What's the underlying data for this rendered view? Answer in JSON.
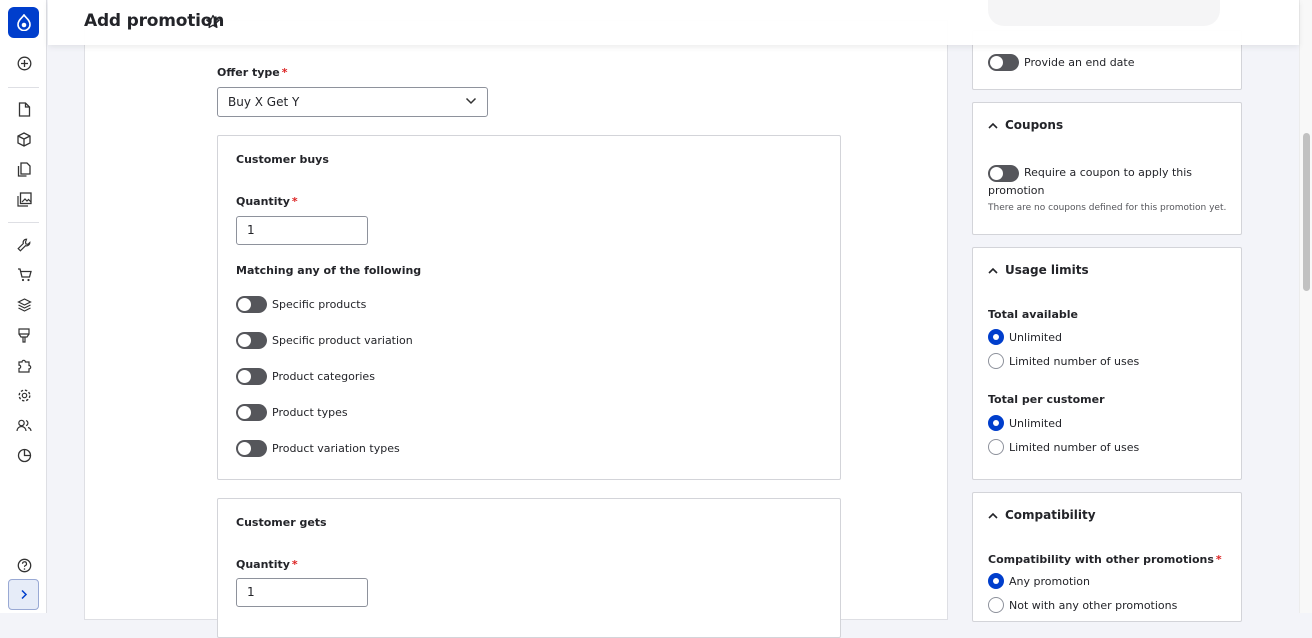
{
  "page": {
    "title": "Add promotion"
  },
  "form": {
    "offer_type_label": "Offer type",
    "offer_type_value": "Buy X Get Y",
    "customer_buys": {
      "legend": "Customer buys",
      "quantity_label": "Quantity",
      "quantity_value": "1",
      "matching_label": "Matching any of the following",
      "toggles": [
        "Specific products",
        "Specific product variation",
        "Product categories",
        "Product types",
        "Product variation types"
      ]
    },
    "customer_gets": {
      "legend": "Customer gets",
      "quantity_label": "Quantity",
      "quantity_value": "1"
    }
  },
  "sidebar_right": {
    "end_date_label": "Provide an end date",
    "coupons": {
      "title": "Coupons",
      "toggle_label": "Require a coupon to apply this promotion",
      "description": "There are no coupons defined for this promotion yet."
    },
    "usage_limits": {
      "title": "Usage limits",
      "total_available_label": "Total available",
      "total_available_options": [
        "Unlimited",
        "Limited number of uses"
      ],
      "total_per_customer_label": "Total per customer",
      "total_per_customer_options": [
        "Unlimited",
        "Limited number of uses"
      ]
    },
    "compatibility": {
      "title": "Compatibility",
      "label": "Compatibility with other promotions",
      "options": [
        "Any promotion",
        "Not with any other promotions"
      ]
    }
  },
  "colors": {
    "accent": "#003ecc",
    "required": "#dc2323"
  }
}
